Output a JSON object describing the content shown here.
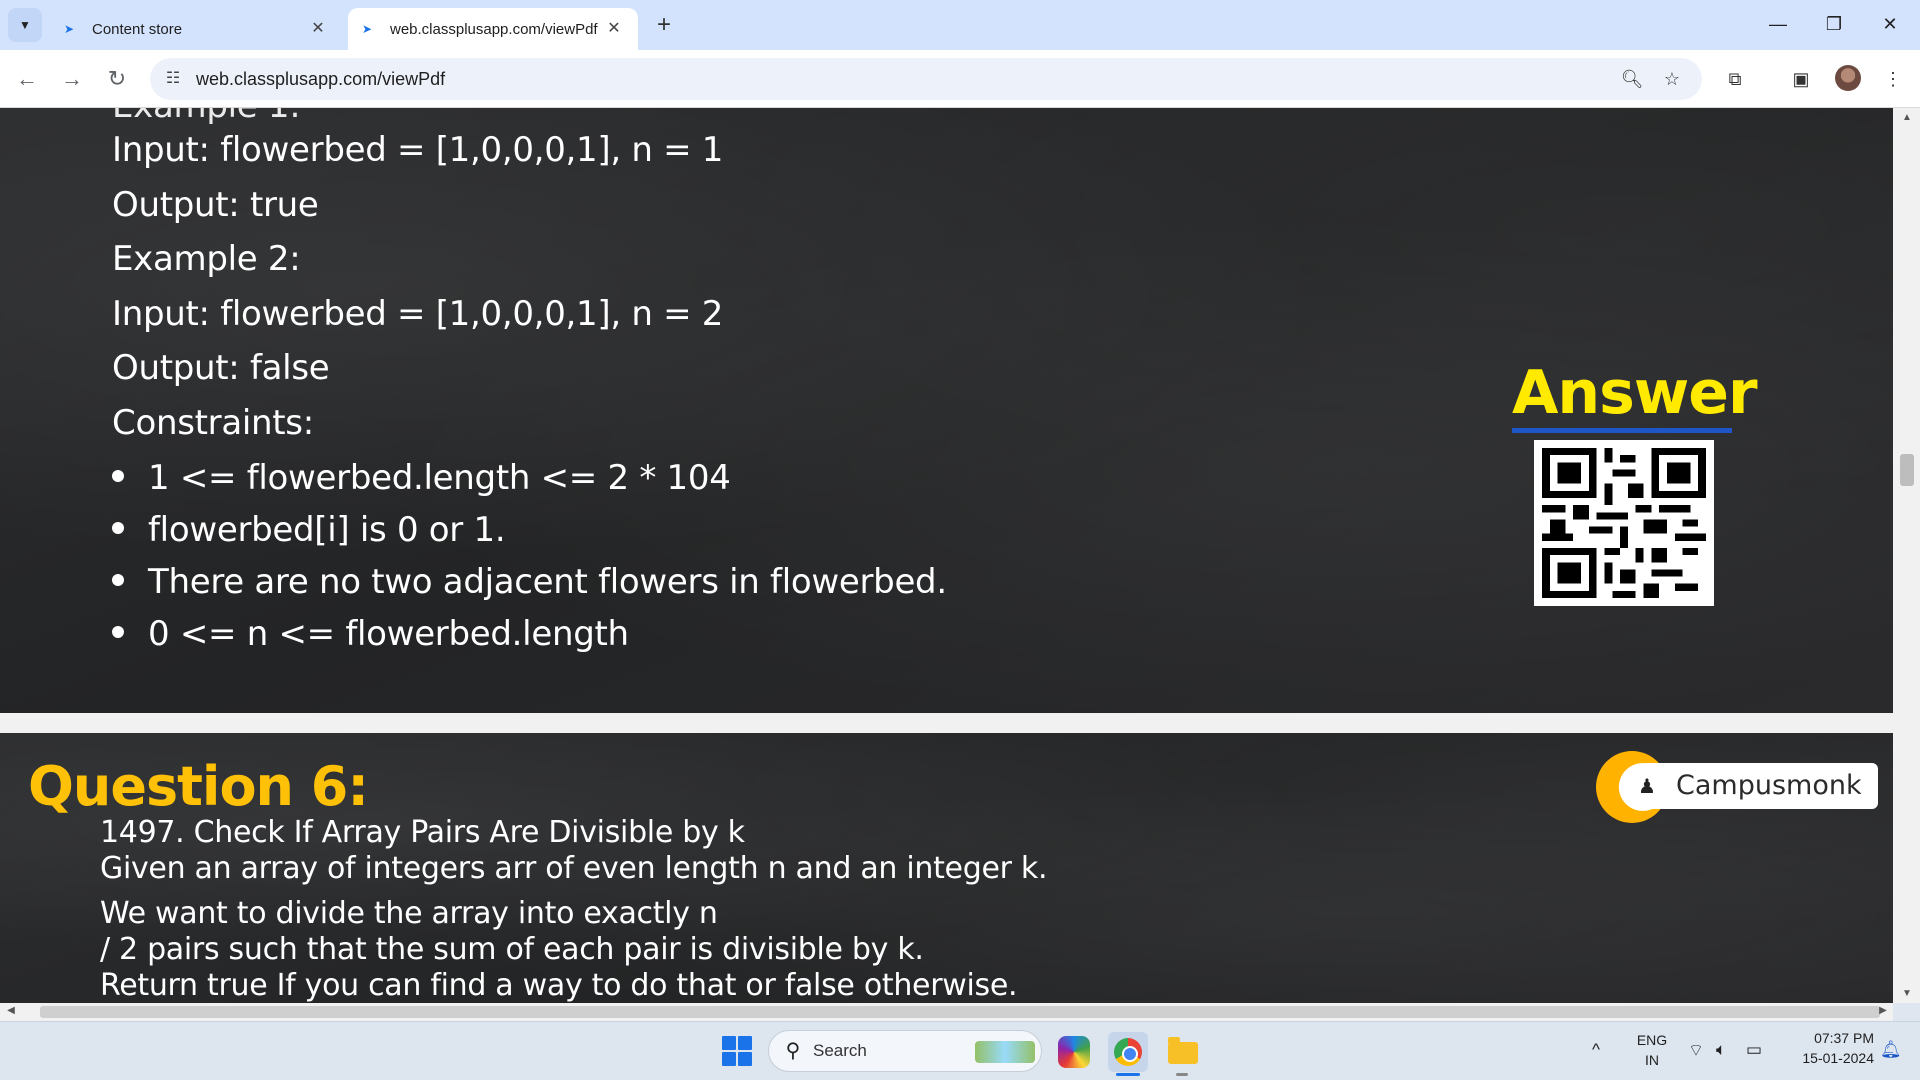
{
  "browser": {
    "tabs": [
      {
        "title": "Content store",
        "active": false
      },
      {
        "title": "web.classplusapp.com/viewPdf",
        "active": true
      }
    ],
    "url": "web.classplusapp.com/viewPdf",
    "icons": [
      "tab-search-icon",
      "back-icon",
      "forward-icon",
      "reload-icon",
      "site-info-icon",
      "zoom-icon",
      "bookmark-star-icon",
      "extensions-icon",
      "side-panel-icon",
      "profile-avatar",
      "menu-icon"
    ]
  },
  "page1": {
    "lines": [
      "Input: flowerbed = [1,0,0,0,1], n = 1",
      "Output: true",
      "Example 2:",
      "Input: flowerbed = [1,0,0,0,1], n = 2",
      "Output: false",
      "Constraints:"
    ],
    "bullets": [
      "1 <= flowerbed.length <= 2 * 104",
      "flowerbed[i] is 0 or 1.",
      "There are no two adjacent flowers in flowerbed.",
      "0 <= n <= flowerbed.length"
    ],
    "answer_label": "Answer"
  },
  "page2": {
    "title": "Question 6:",
    "brand": "Campusmonk",
    "lines": [
      "1497. Check If Array Pairs Are Divisible by k",
      "Given an array of integers arr of even length n and an integer k.",
      "We want to divide the array into exactly n",
      "/ 2 pairs such that the sum of each pair is divisible by k.",
      "Return true If you can find a way to do that or false otherwise."
    ]
  },
  "taskbar": {
    "search_label": "Search",
    "language": "ENG",
    "region": "IN",
    "time": "07:37 PM",
    "date": "15-01-2024"
  },
  "colors": {
    "question_title": "#ffc107",
    "answer_label": "#ffea00",
    "slide_bg": "#262729",
    "tab_strip": "#d3e3fd"
  }
}
